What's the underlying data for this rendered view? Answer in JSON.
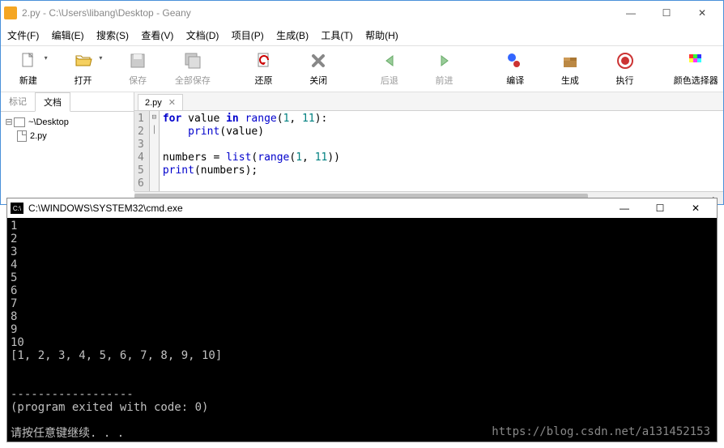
{
  "window": {
    "title": "2.py - C:\\Users\\libang\\Desktop - Geany"
  },
  "menu": {
    "file": "文件(F)",
    "edit": "编辑(E)",
    "search": "搜索(S)",
    "view": "查看(V)",
    "document": "文档(D)",
    "project": "项目(P)",
    "build": "生成(B)",
    "tools": "工具(T)",
    "help": "帮助(H)"
  },
  "toolbar": {
    "new": "新建",
    "open": "打开",
    "save": "保存",
    "save_all": "全部保存",
    "revert": "还原",
    "close": "关闭",
    "back": "后退",
    "forward": "前进",
    "compile": "编译",
    "build": "生成",
    "execute": "执行",
    "color": "颜色选择器"
  },
  "sidebar": {
    "tab_symbols": "标记",
    "tab_documents": "文档",
    "folder": "~\\Desktop",
    "file": "2.py"
  },
  "editor": {
    "tab": "2.py",
    "lines": [
      "1",
      "2",
      "3",
      "4",
      "5",
      "6"
    ],
    "fold": "⊟\n│\n\n\n\n",
    "code_tokens": [
      [
        {
          "t": "for ",
          "c": "kw"
        },
        {
          "t": "value ",
          "c": "id"
        },
        {
          "t": "in ",
          "c": "kw"
        },
        {
          "t": "range",
          "c": "btn-blue"
        },
        {
          "t": "(",
          "c": "id"
        },
        {
          "t": "1",
          "c": "num"
        },
        {
          "t": ", ",
          "c": "id"
        },
        {
          "t": "11",
          "c": "num"
        },
        {
          "t": "):",
          "c": "id"
        }
      ],
      [
        {
          "t": "    print",
          "c": "btn-blue"
        },
        {
          "t": "(value)",
          "c": "id"
        }
      ],
      [],
      [
        {
          "t": "numbers ",
          "c": "id"
        },
        {
          "t": "= ",
          "c": "id"
        },
        {
          "t": "list",
          "c": "btn-blue"
        },
        {
          "t": "(",
          "c": "id"
        },
        {
          "t": "range",
          "c": "btn-blue"
        },
        {
          "t": "(",
          "c": "id"
        },
        {
          "t": "1",
          "c": "num"
        },
        {
          "t": ", ",
          "c": "id"
        },
        {
          "t": "11",
          "c": "num"
        },
        {
          "t": "))",
          "c": "id"
        }
      ],
      [
        {
          "t": "print",
          "c": "btn-blue"
        },
        {
          "t": "(numbers);",
          "c": "id"
        }
      ],
      []
    ]
  },
  "console": {
    "title": "C:\\WINDOWS\\SYSTEM32\\cmd.exe",
    "output": "1\n2\n3\n4\n5\n6\n7\n8\n9\n10\n[1, 2, 3, 4, 5, 6, 7, 8, 9, 10]\n\n\n------------------\n(program exited with code: 0)\n\n请按任意键继续. . .",
    "watermark": "https://blog.csdn.net/a131452153"
  }
}
